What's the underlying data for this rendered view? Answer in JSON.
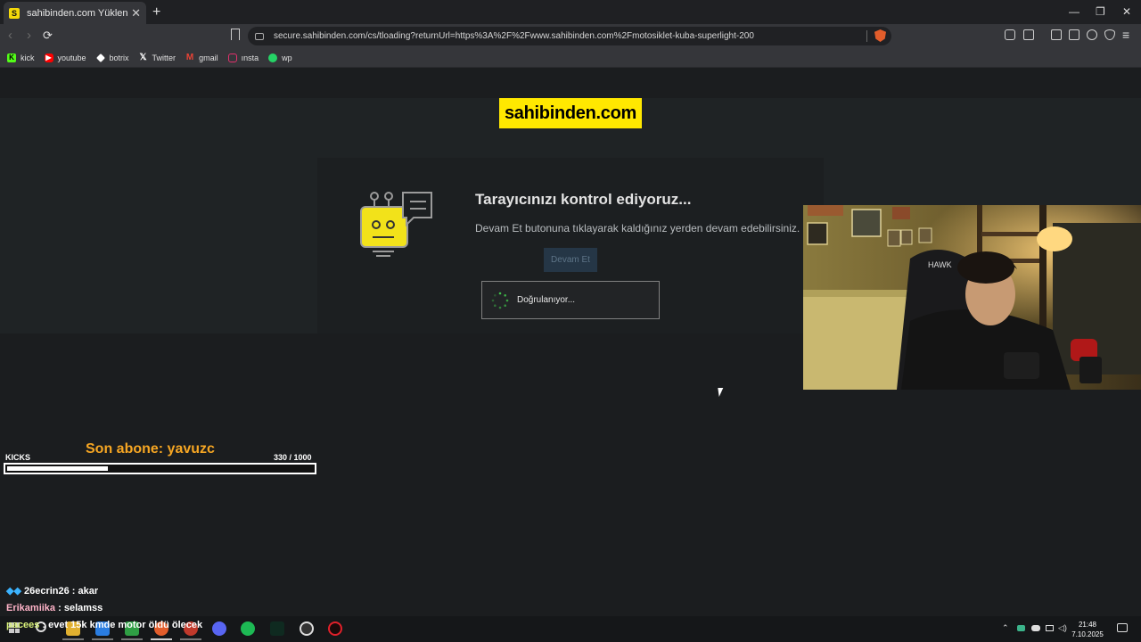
{
  "browser": {
    "tab_title": "sahibinden.com Yükleniyor",
    "tab_favicon": "S",
    "new_tab": "+",
    "url": "secure.sahibinden.com/cs/tloading?returnUrl=https%3A%2F%2Fwww.sahibinden.com%2Fmotosiklet-kuba-superlight-200",
    "bookmarks": [
      {
        "label": "kick",
        "icon": "kick-icon",
        "color": "#53fc18"
      },
      {
        "label": "youtube",
        "icon": "youtube-icon",
        "color": "#ff0000"
      },
      {
        "label": "botrix",
        "icon": "botrix-icon",
        "color": "#ffffff"
      },
      {
        "label": "Twitter",
        "icon": "x-icon",
        "color": "#ffffff"
      },
      {
        "label": "gmail",
        "icon": "gmail-icon",
        "color": "#ea4335"
      },
      {
        "label": "ınsta",
        "icon": "instagram-icon",
        "color": "#e1306c"
      },
      {
        "label": "wp",
        "icon": "whatsapp-icon",
        "color": "#25d366"
      }
    ]
  },
  "page": {
    "logo_text": "sahibinden.com",
    "heading": "Tarayıcınızı kontrol ediyoruz...",
    "subtext": "Devam Et butonuna tıklayarak kaldığınız yerden devam edebilirsiniz.",
    "continue_button": "Devam Et",
    "verify_text": "Doğrulanıyor..."
  },
  "overlay": {
    "last_sub": "Son abone: yavuzc",
    "kicks_label": "KICKS",
    "kicks_count": "330  / 1000",
    "kicks_progress": 0.33,
    "chat": [
      {
        "user": "26ecrin26",
        "message": "akar",
        "color": "#ffffff"
      },
      {
        "user": "Erikamiika",
        "message": "selamss",
        "color": "#ffb3c8"
      },
      {
        "user": "pacees",
        "message": "evet 15k kmde motor öldü ölecek",
        "color": "#d9f27a"
      }
    ]
  },
  "taskbar": {
    "time": "21:48",
    "date": "7.10.2025"
  }
}
